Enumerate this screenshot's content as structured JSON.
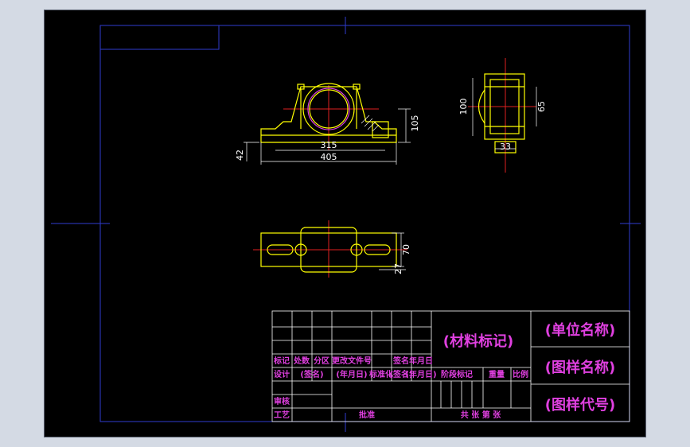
{
  "title_block": {
    "material": "(材料标记)",
    "unit_name": "(单位名称)",
    "drawing_name": "(图样名称)",
    "drawing_code": "(图样代号)",
    "row_headers": [
      "标记",
      "处数",
      "分区",
      "更改文件号",
      "签名",
      "年月日"
    ],
    "design_row": [
      "设计",
      "(签名)",
      "(年月日)",
      "标准化",
      "(签名)",
      "(年月日)"
    ],
    "stage_labels": [
      "阶段标记",
      "重量",
      "比例"
    ],
    "review": "审核",
    "process": "工艺",
    "approve": "批准",
    "sheets": "共 张 第 张"
  },
  "front_view": {
    "dims": [
      "315",
      "405",
      "105",
      "42"
    ]
  },
  "side_view": {
    "dims": [
      "100",
      "65",
      "33"
    ]
  },
  "top_view": {
    "dims": [
      "70",
      "27"
    ]
  },
  "colors": {
    "background": "#000000",
    "frame": "#2f3ccf",
    "centerline": "#e02020",
    "outline": "#ffff00",
    "dimension": "#ffffff",
    "annotation": "#e040e0",
    "tb_line": "#ffffff"
  }
}
